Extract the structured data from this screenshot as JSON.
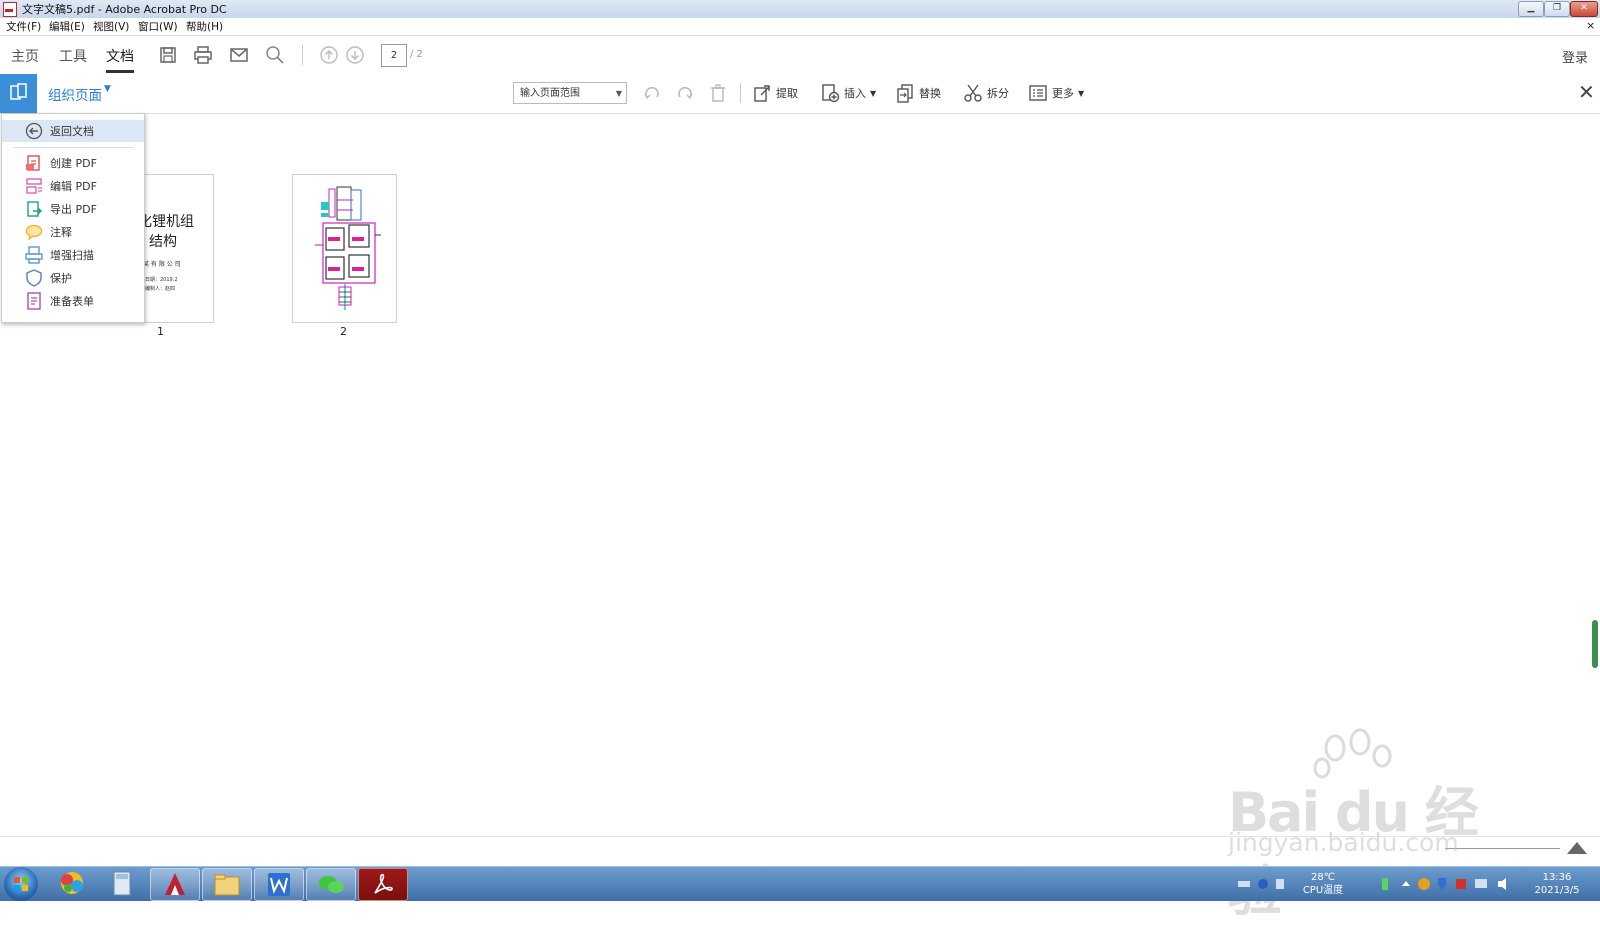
{
  "window": {
    "title": "文字文稿5.pdf - Adobe Acrobat Pro DC"
  },
  "menubar": {
    "items": [
      "文件(F)",
      "编辑(E)",
      "视图(V)",
      "窗口(W)",
      "帮助(H)"
    ],
    "close": "×"
  },
  "nav": {
    "tabs": [
      "主页",
      "工具",
      "文档"
    ],
    "active_tab": "文档",
    "current_page": "2",
    "total_pages": "/ 2",
    "login": "登录"
  },
  "organize": {
    "title": "组织页面",
    "range_placeholder": "输入页面范围",
    "tools": {
      "extract": "提取",
      "insert": "插入",
      "replace": "替换",
      "split": "拆分",
      "more": "更多"
    }
  },
  "dropdown": {
    "back": "返回文档",
    "items": [
      "创建 PDF",
      "编辑 PDF",
      "导出 PDF",
      "注释",
      "增强扫描",
      "保护",
      "准备表单"
    ]
  },
  "pages": [
    {
      "number": "1",
      "title_line1": "化锂机组",
      "title_line2": "结构",
      "company": "某 有 限 公 司",
      "date": "日期：2019.2",
      "author": "编制人：赵四"
    },
    {
      "number": "2"
    }
  ],
  "tray": {
    "temp": "28℃",
    "temp_label": "CPU温度",
    "time": "13:36",
    "date": "2021/3/5"
  },
  "watermark": {
    "brand": "Bai du 经验",
    "url": "jingyan.baidu.com"
  },
  "colors": {
    "accent": "#2a7fd4",
    "taskbar": "#3f6fa8"
  }
}
